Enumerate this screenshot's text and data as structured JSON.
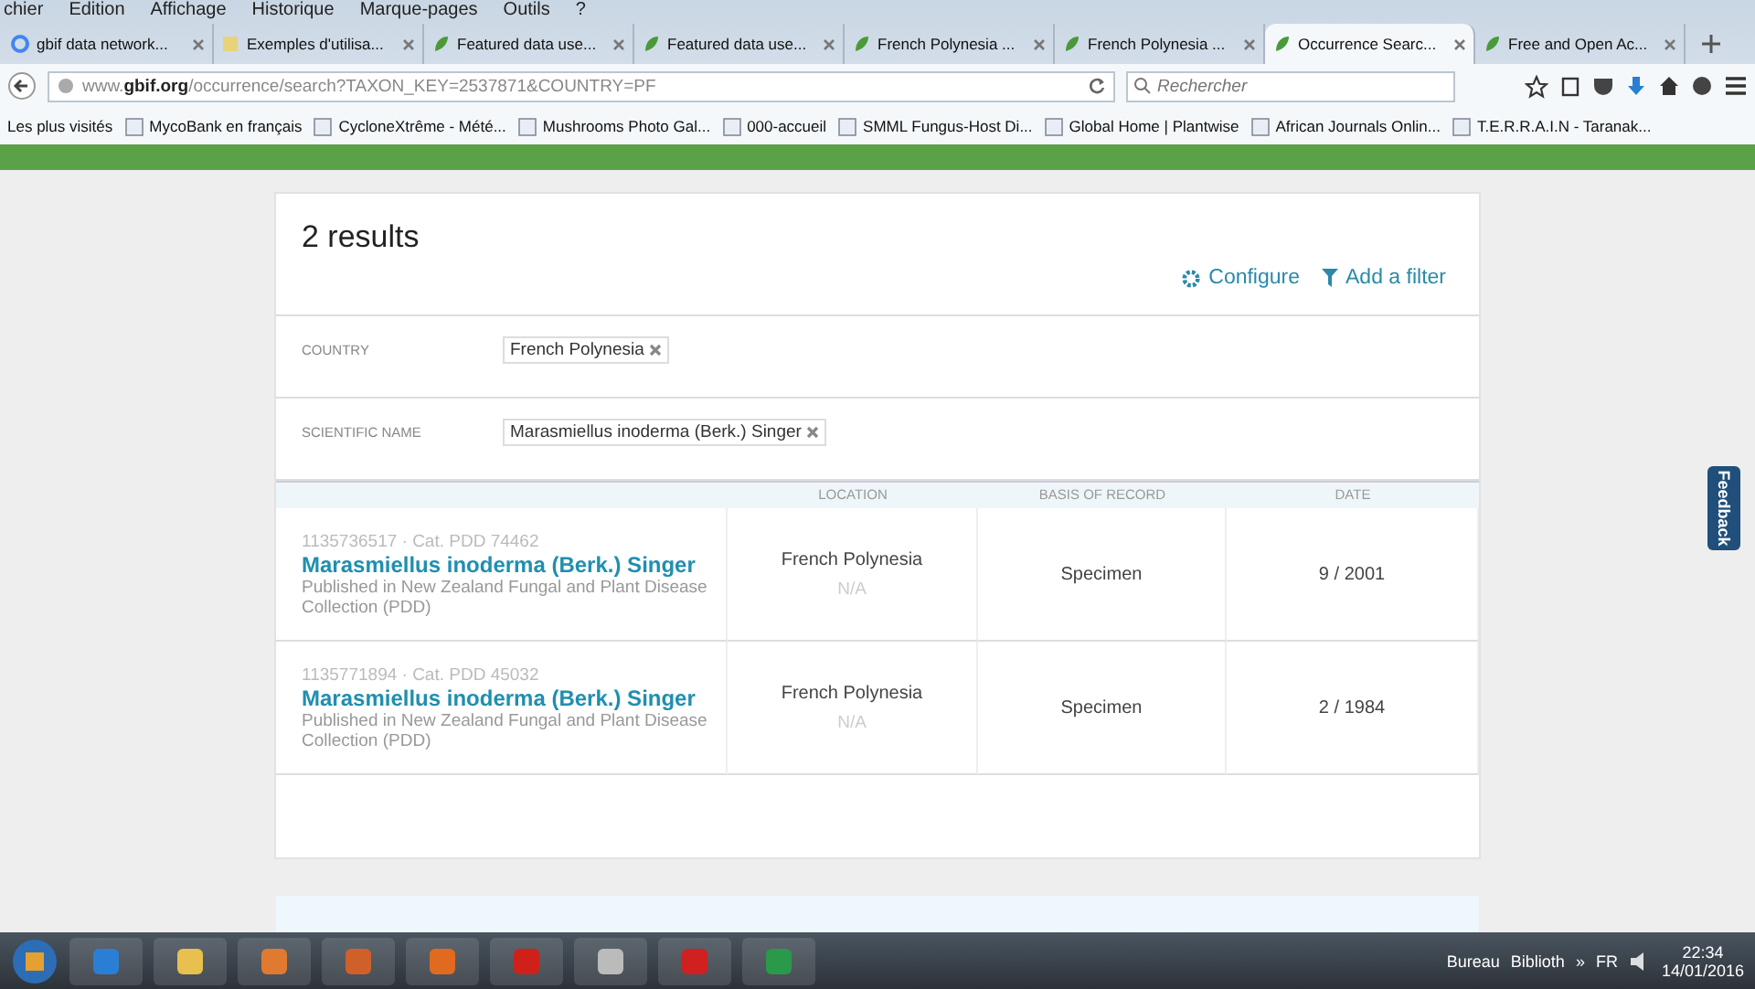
{
  "menu": [
    "chier",
    "Edition",
    "Affichage",
    "Historique",
    "Marque-pages",
    "Outils",
    "?"
  ],
  "tabs": [
    {
      "label": "gbif data network...",
      "kind": "search",
      "selected": false
    },
    {
      "label": "Exemples d'utilisa...",
      "kind": "document",
      "selected": false
    },
    {
      "label": "Featured data use...",
      "kind": "site",
      "selected": false
    },
    {
      "label": "Featured data use...",
      "kind": "site",
      "selected": false
    },
    {
      "label": "French Polynesia ...",
      "kind": "site",
      "selected": false
    },
    {
      "label": "French Polynesia ...",
      "kind": "site",
      "selected": false
    },
    {
      "label": "Occurrence Searc...",
      "kind": "site",
      "selected": true
    },
    {
      "label": "Free and Open Ac...",
      "kind": "site",
      "selected": false
    }
  ],
  "address": {
    "domain_pre": "www.",
    "domain": "gbif.org",
    "path": "/occurrence/search?TAXON_KEY=2537871&COUNTRY=PF"
  },
  "search": {
    "placeholder": "Rechercher"
  },
  "bookmarks": [
    "Les plus visités",
    "MycoBank en français",
    "CycloneXtrême - Mété...",
    "Mushrooms Photo Gal...",
    "000-accueil",
    "SMML Fungus-Host Di...",
    "Global Home | Plantwise",
    "African Journals Onlin...",
    "T.E.R.R.A.I.N - Taranak..."
  ],
  "results": {
    "title": "2 results",
    "actions": [
      "Configure",
      "Add a filter"
    ],
    "filters": [
      {
        "label": "COUNTRY",
        "value": "French Polynesia"
      },
      {
        "label": "SCIENTIFIC NAME",
        "value": "Marasmiellus inoderma (Berk.) Singer"
      }
    ],
    "columns": [
      "LOCATION",
      "BASIS OF RECORD",
      "DATE"
    ],
    "rows": [
      {
        "id": "1135736517 · Cat. PDD 74462",
        "name": "Marasmiellus inoderma (Berk.) Singer",
        "published": "Published in New Zealand Fungal and Plant Disease Collection (PDD)",
        "location": "French Polynesia",
        "coords": "N/A",
        "basis": "Specimen",
        "date": "9 / 2001"
      },
      {
        "id": "1135771894 · Cat. PDD 45032",
        "name": "Marasmiellus inoderma (Berk.) Singer",
        "published": "Published in New Zealand Fungal and Plant Disease Collection (PDD)",
        "location": "French Polynesia",
        "coords": "N/A",
        "basis": "Specimen",
        "date": "2 / 1984"
      }
    ]
  },
  "feedback": "Feedback",
  "taskbar": {
    "toolbars": [
      "Bureau",
      "Biblioth",
      "»"
    ],
    "lang": "FR",
    "time": "22:34",
    "date": "14/01/2016"
  }
}
